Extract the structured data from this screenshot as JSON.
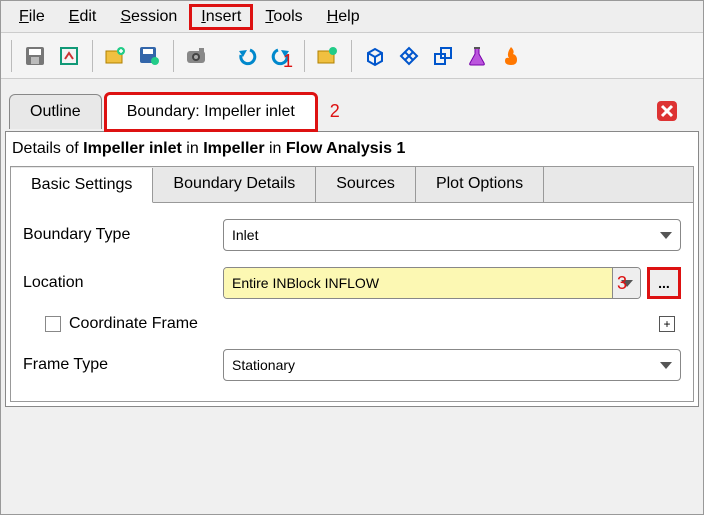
{
  "menu": {
    "file": "File",
    "edit": "Edit",
    "session": "Session",
    "insert": "Insert",
    "tools": "Tools",
    "help": "Help"
  },
  "annotations": {
    "one": "1",
    "two": "2",
    "three": "3"
  },
  "panel_tabs": {
    "outline": "Outline",
    "boundary": "Boundary: Impeller inlet"
  },
  "details_line": {
    "prefix": "Details of ",
    "a": "Impeller inlet",
    "mid1": " in ",
    "b": "Impeller",
    "mid2": " in ",
    "c": "Flow Analysis 1"
  },
  "inner_tabs": {
    "basic": "Basic Settings",
    "bd": "Boundary Details",
    "src": "Sources",
    "plot": "Plot Options"
  },
  "form": {
    "boundary_type_label": "Boundary Type",
    "boundary_type_value": "Inlet",
    "location_label": "Location",
    "location_value": "Entire INBlock INFLOW",
    "more": "...",
    "coord_frame": "Coordinate Frame",
    "expand": "+",
    "frame_type_label": "Frame Type",
    "frame_type_value": "Stationary"
  }
}
